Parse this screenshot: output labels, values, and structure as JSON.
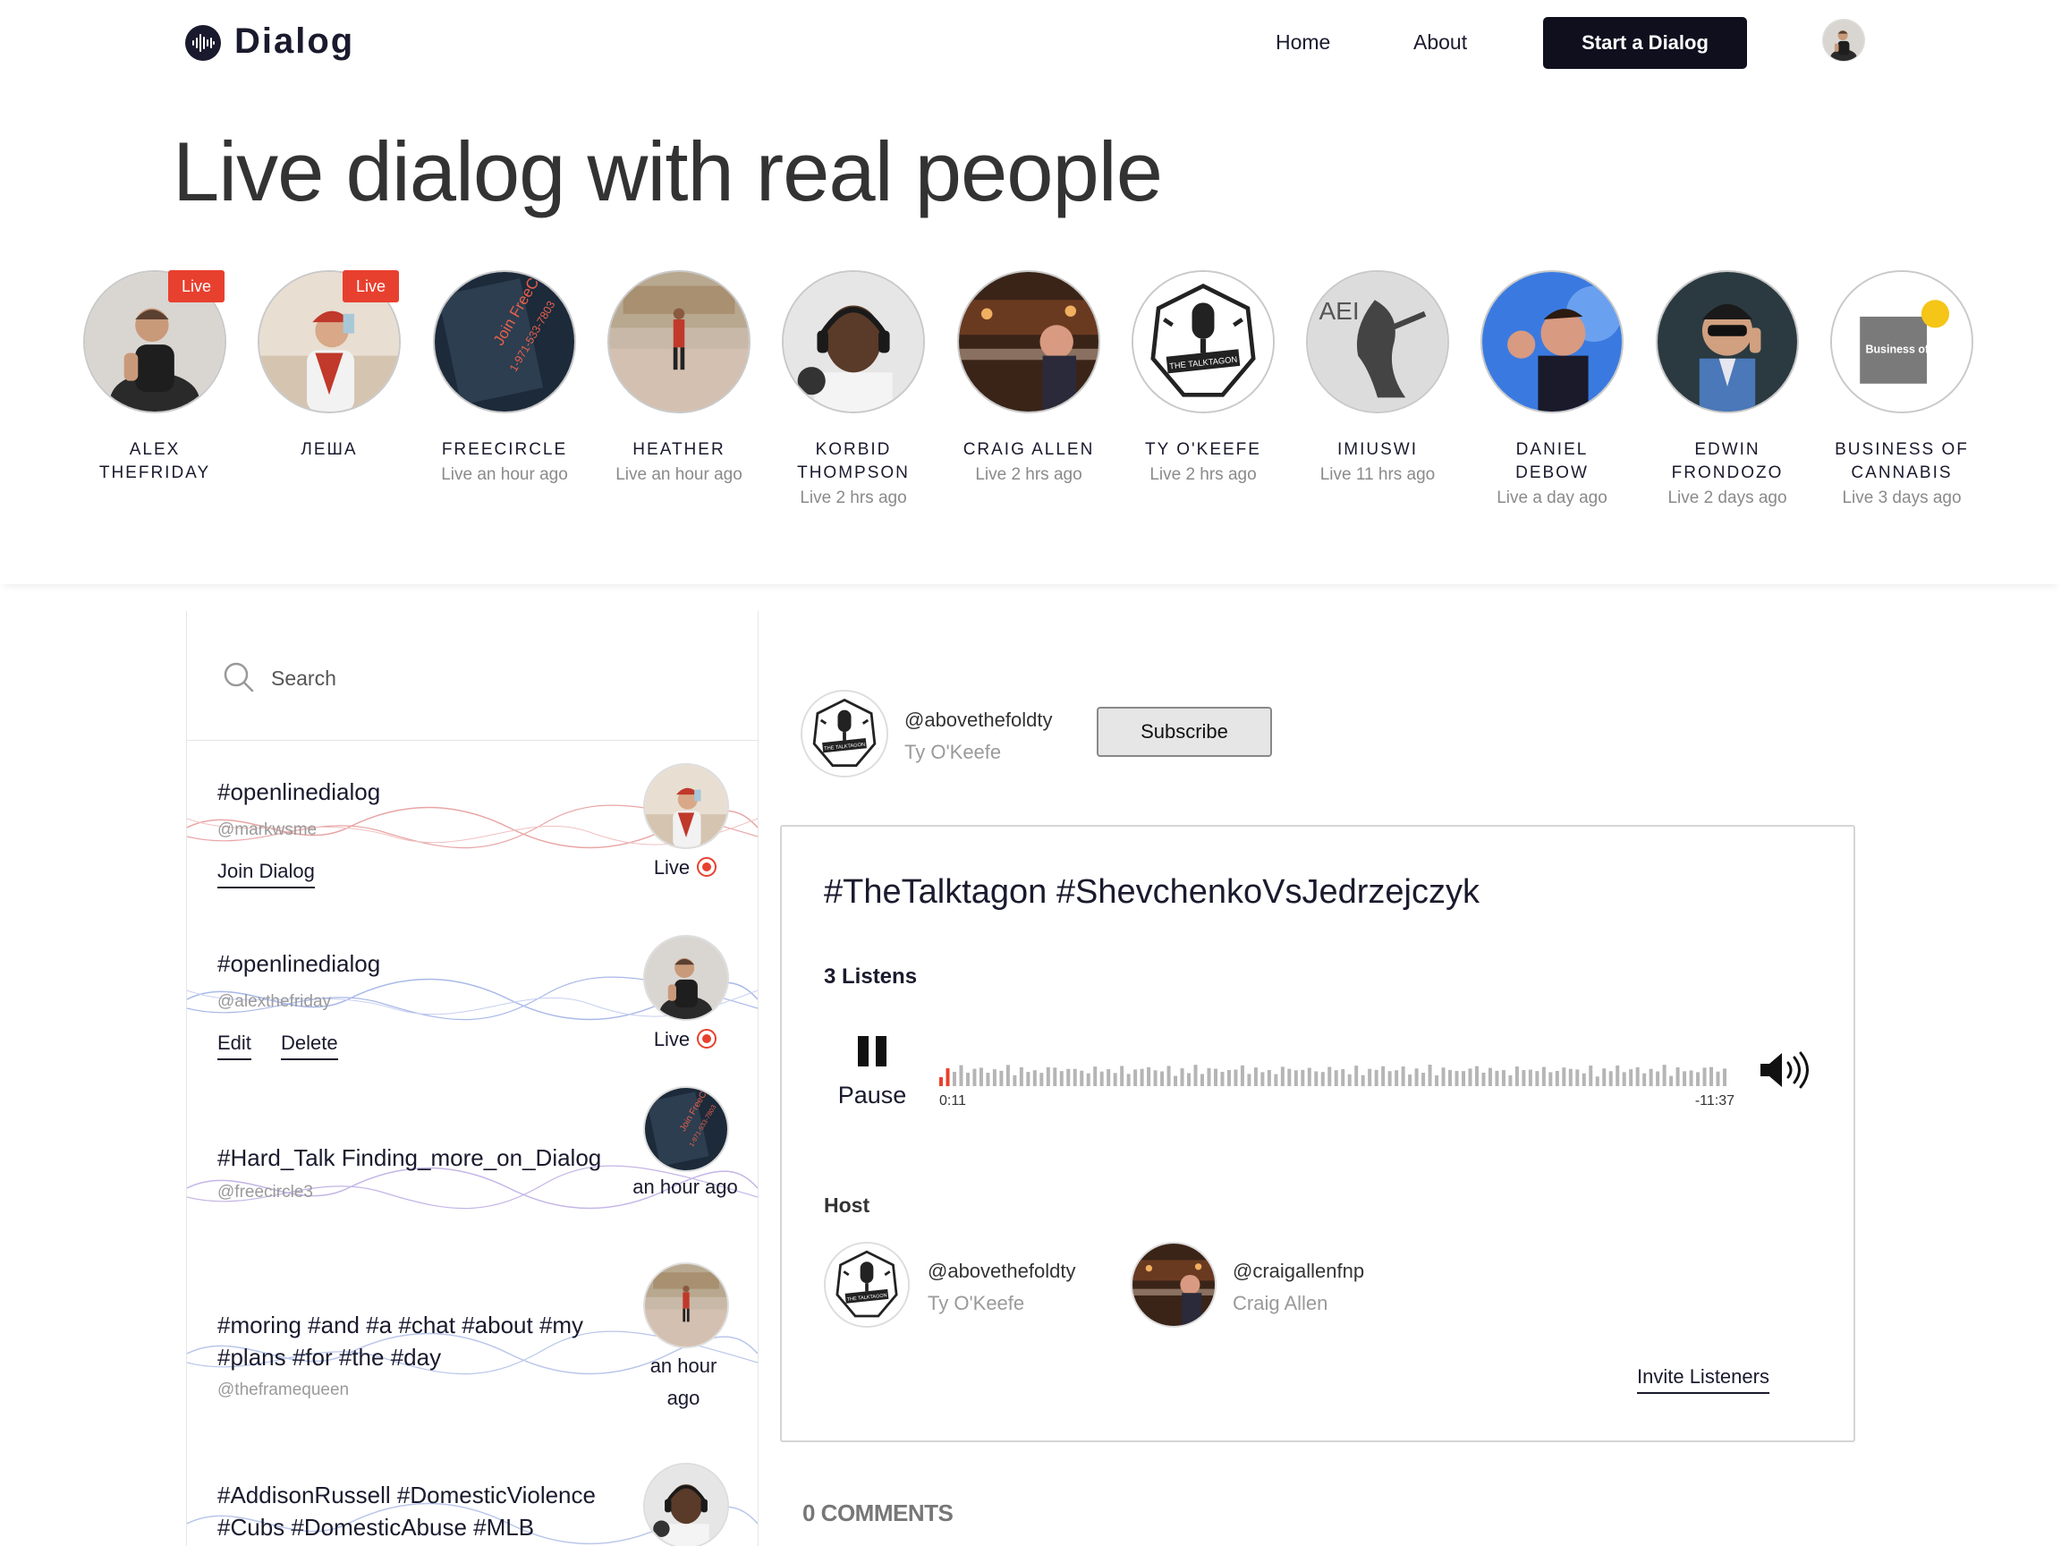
{
  "brand": {
    "name": "Dialog"
  },
  "nav": {
    "home": "Home",
    "about": "About",
    "start": "Start a Dialog"
  },
  "hero": {
    "title": "Live dialog with real people",
    "profiles": [
      {
        "name": "ALEX THEFRIDAY",
        "status": "",
        "live": true,
        "live_label": "Live",
        "avatar": "person-black-shirt"
      },
      {
        "name": "ЛЕША",
        "status": "",
        "live": true,
        "live_label": "Live",
        "avatar": "person-red-cap"
      },
      {
        "name": "FREECIRCLE",
        "status": "Live an hour ago",
        "live": false,
        "avatar": "freecircle-sign"
      },
      {
        "name": "HEATHER",
        "status": "Live an hour ago",
        "live": false,
        "avatar": "person-plaza"
      },
      {
        "name": "KORBID THOMPSON",
        "status": "Live 2 hrs ago",
        "live": false,
        "avatar": "person-headphones"
      },
      {
        "name": "CRAIG ALLEN",
        "status": "Live 2 hrs ago",
        "live": false,
        "avatar": "person-bar"
      },
      {
        "name": "TY O'KEEFE",
        "status": "Live 2 hrs ago",
        "live": false,
        "avatar": "talktagon-logo"
      },
      {
        "name": "IMIUSWI",
        "status": "Live 11 hrs ago",
        "live": false,
        "avatar": "aei-logo"
      },
      {
        "name": "DANIEL DEBOW",
        "status": "Live a day ago",
        "live": false,
        "avatar": "person-shouting"
      },
      {
        "name": "EDWIN FRONDOZO",
        "status": "Live 2 days ago",
        "live": false,
        "avatar": "person-sunglasses"
      },
      {
        "name": "BUSINESS OF CANNABIS",
        "status": "Live 3 days ago",
        "live": false,
        "avatar": "business-of-cannabis-logo",
        "logo_text": "Business of Cannabis"
      }
    ]
  },
  "sidebar": {
    "search_placeholder": "Search",
    "items": [
      {
        "title": "#openlinedialog",
        "handle": "@markwsme",
        "status": "Live",
        "actions": [
          "Join Dialog"
        ],
        "wave_color": "#e8a5a5",
        "avatar": "person-red-cap"
      },
      {
        "title": "#openlinedialog",
        "handle": "@alexthefriday",
        "status": "Live",
        "actions": [
          "Edit",
          "Delete"
        ],
        "wave_color": "#a9b8e8",
        "avatar": "person-black-shirt"
      },
      {
        "title": "#Hard_Talk Finding_more_on_Dialog",
        "handle": "@freecircle3",
        "status": "an hour ago",
        "actions": [],
        "wave_color": "#c4b5e6",
        "avatar": "freecircle-sign"
      },
      {
        "title": "#moring #and #a #chat #about #my #plans #for #the #day",
        "handle": "@theframequeen",
        "status": "an hour ago",
        "actions": [],
        "wave_color": "#b9c6ea",
        "avatar": "person-plaza"
      },
      {
        "title": "#AddisonRussell #DomesticViolence #Cubs #DomesticAbuse #MLB",
        "handle": "",
        "status": "",
        "actions": [],
        "wave_color": "#b9c6ea",
        "avatar": "person-headphones"
      }
    ]
  },
  "dialog": {
    "owner_handle": "@abovethefoldty",
    "owner_name": "Ty O'Keefe",
    "subscribe_label": "Subscribe",
    "title": "#TheTalktagon #ShevchenkoVsJedrzejczyk",
    "listens": "3 Listens",
    "pause_label": "Pause",
    "time_current": "0:11",
    "time_remaining": "-11:37",
    "progress": 0.015,
    "host_label": "Host",
    "hosts": [
      {
        "handle": "@abovethefoldty",
        "name": "Ty O'Keefe",
        "avatar": "talktagon-logo"
      },
      {
        "handle": "@craigallenfnp",
        "name": "Craig Allen",
        "avatar": "person-bar"
      }
    ],
    "invite_label": "Invite Listeners",
    "comments_label": "0 COMMENTS"
  },
  "colors": {
    "accent_dark": "#0f0f1e",
    "live_red": "#e8402f",
    "wave_progress": "#e8402f",
    "wave_rest": "#b5b5b5"
  }
}
